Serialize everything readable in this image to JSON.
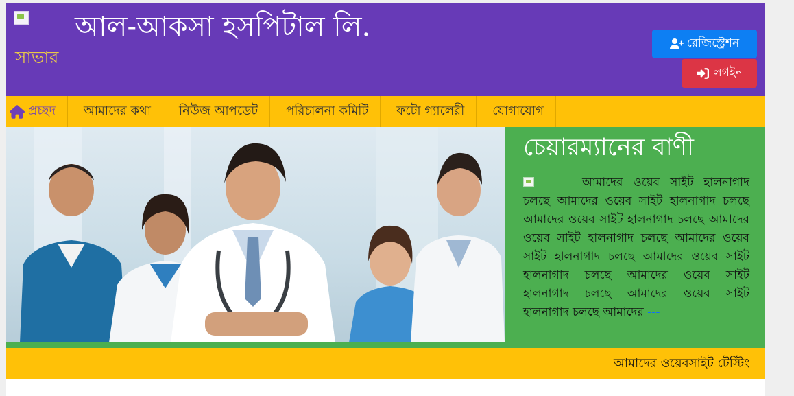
{
  "header": {
    "hospital_name": "আল-আকসা হসপিটাল লি.",
    "location": "সাভার",
    "register_label": "রেজিস্ট্রেশন",
    "login_label": "লগইন",
    "icons": {
      "register": "user-plus-icon",
      "login": "sign-in-icon"
    }
  },
  "nav": {
    "items": [
      {
        "label": "প্রচ্ছদ",
        "icon": "home-icon"
      },
      {
        "label": "আমাদের কথা"
      },
      {
        "label": "নিউজ আপডেট"
      },
      {
        "label": "পরিচালনা কমিটি"
      },
      {
        "label": "ফটো গ্যালেরী"
      },
      {
        "label": "যোগাযোগ"
      }
    ]
  },
  "chairman": {
    "title": "চেয়ারম্যানের বাণী",
    "message": "আমাদের ওয়েব সাইট হালনাগাদ চলছে আমাদের ওয়েব সাইট হালনাগাদ চলছে আমাদের ওয়েব সাইট হালনাগাদ চলছে আমাদের ওয়েব সাইট হালনাগাদ চলছে আমাদের ওয়েব সাইট হালনাগাদ চলছে আমাদের ওয়েব সাইট হালনাগাদ চলছে আমাদের ওয়েব সাইট হালনাগাদ চলছে আমাদের ওয়েব সাইট হালনাগাদ চলছে আমাদের",
    "more_link": "---"
  },
  "marquee": {
    "text": "আমাদের ওয়েবসাইট টেস্টিং"
  },
  "colors": {
    "header_bg": "#673ab7",
    "nav_bg": "#ffc107",
    "panel_bg": "#4caf50",
    "register_btn": "#0d7ff3",
    "login_btn": "#dc3545",
    "location_text": "#e9c84a"
  }
}
